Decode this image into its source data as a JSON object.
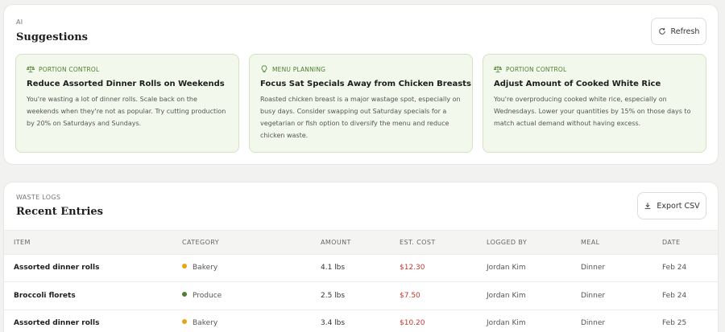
{
  "ai_section": {
    "eyebrow": "AI",
    "heading": "Suggestions",
    "refresh_label": "Refresh",
    "suggestions": [
      {
        "tag": "PORTION CONTROL",
        "icon": "scale-icon",
        "title": "Reduce Assorted Dinner Rolls on Weekends",
        "body": "You're wasting a lot of dinner rolls. Scale back on the weekends when they're not as popular. Try cutting production by 20% on Saturdays and Sundays."
      },
      {
        "tag": "MENU PLANNING",
        "icon": "lightbulb-icon",
        "title": "Focus Sat Specials Away from Chicken Breasts",
        "body": "Roasted chicken breast is a major wastage spot, especially on busy days. Consider swapping out Saturday specials for a vegetarian or fish option to diversify the menu and reduce chicken waste."
      },
      {
        "tag": "PORTION CONTROL",
        "icon": "scale-icon",
        "title": "Adjust Amount of Cooked White Rice",
        "body": "You're overproducing cooked white rice, especially on Wednesdays. Lower your quantities by 15% on those days to match actual demand without having excess."
      }
    ]
  },
  "waste_section": {
    "eyebrow": "WASTE LOGS",
    "heading": "Recent Entries",
    "export_label": "Export CSV",
    "columns": [
      "ITEM",
      "CATEGORY",
      "AMOUNT",
      "EST. COST",
      "LOGGED BY",
      "MEAL",
      "DATE"
    ],
    "rows": [
      {
        "item": "Assorted dinner rolls",
        "category": "Bakery",
        "category_color": "#e8a317",
        "amount": "4.1 lbs",
        "cost": "$12.30",
        "logged_by": "Jordan Kim",
        "meal": "Dinner",
        "date": "Feb 24"
      },
      {
        "item": "Broccoli florets",
        "category": "Produce",
        "category_color": "#4f7f2f",
        "amount": "2.5 lbs",
        "cost": "$7.50",
        "logged_by": "Jordan Kim",
        "meal": "Dinner",
        "date": "Feb 24"
      },
      {
        "item": "Assorted dinner rolls",
        "category": "Bakery",
        "category_color": "#e8a317",
        "amount": "3.4 lbs",
        "cost": "$10.20",
        "logged_by": "Jordan Kim",
        "meal": "Dinner",
        "date": "Feb 25"
      }
    ]
  }
}
